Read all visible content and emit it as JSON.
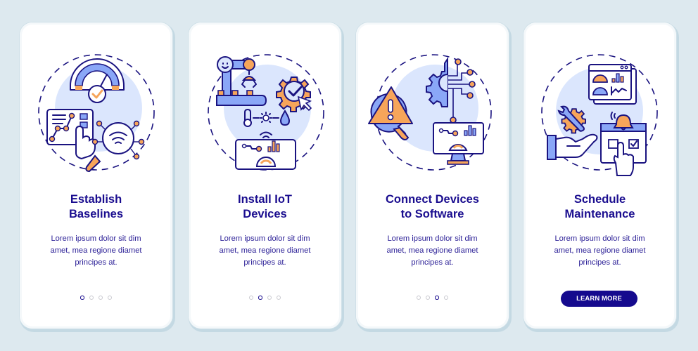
{
  "colors": {
    "background": "#dde9ef",
    "card": "#ffffff",
    "title": "#1a0d8f",
    "accent_orange": "#f7a55a",
    "accent_blue": "#8aa7f7",
    "light_circle": "#dbe6fd",
    "button": "#150a8e"
  },
  "cards": [
    {
      "illustration": "baseline-gauge-analytics-icon",
      "title_line1": "Establish",
      "title_line2": "Baselines",
      "desc_line1": "Lorem ipsum dolor sit dim",
      "desc_line2": "amet, mea regione diamet",
      "desc_line3": "principes at.",
      "active_page": 1
    },
    {
      "illustration": "robot-arm-gear-sensors-icon",
      "title_line1": "Install IoT",
      "title_line2": "Devices",
      "desc_line1": "Lorem ipsum dolor sit dim",
      "desc_line2": "amet, mea regione diamet",
      "desc_line3": "principes at.",
      "active_page": 2
    },
    {
      "illustration": "warning-gear-monitor-icon",
      "title_line1": "Connect Devices",
      "title_line2": "to Software",
      "desc_line1": "Lorem ipsum dolor sit dim",
      "desc_line2": "amet, mea regione diamet",
      "desc_line3": "principes at.",
      "active_page": 3
    },
    {
      "illustration": "maintenance-calendar-dashboard-icon",
      "title_line1": "Schedule",
      "title_line2": "Maintenance",
      "desc_line1": "Lorem ipsum dolor sit dim",
      "desc_line2": "amet, mea regione diamet",
      "desc_line3": "principes at.",
      "button_label": "LEARN MORE"
    }
  ],
  "pagination": {
    "total": 4
  }
}
